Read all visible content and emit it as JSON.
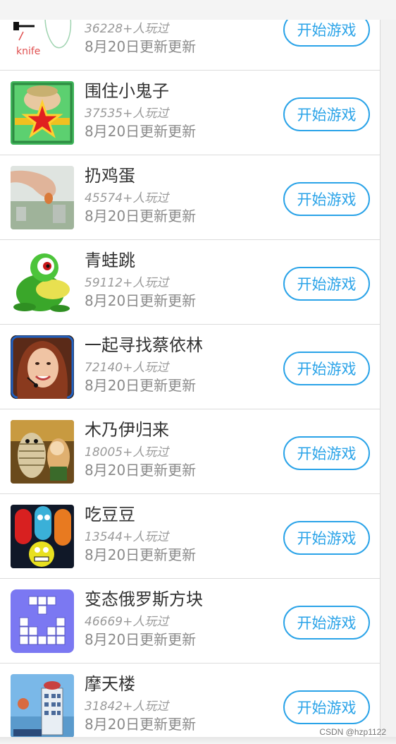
{
  "games": [
    {
      "name": "",
      "plays": "36228+人玩过",
      "updated": "8月20日更新更新",
      "button": "开始游戏",
      "icon": "knife-sketch-icon"
    },
    {
      "name": "围住小鬼子",
      "plays": "37535+人玩过",
      "updated": "8月20日更新更新",
      "button": "开始游戏",
      "icon": "red-star-soldier-icon"
    },
    {
      "name": "扔鸡蛋",
      "plays": "45574+人玩过",
      "updated": "8月20日更新更新",
      "button": "开始游戏",
      "icon": "hand-egg-icon"
    },
    {
      "name": "青蛙跳",
      "plays": "59112+人玩过",
      "updated": "8月20日更新更新",
      "button": "开始游戏",
      "icon": "green-frog-icon"
    },
    {
      "name": "一起寻找蔡依林",
      "plays": "72140+人玩过",
      "updated": "8月20日更新更新",
      "button": "开始游戏",
      "icon": "singer-portrait-icon"
    },
    {
      "name": "木乃伊归来",
      "plays": "18005+人玩过",
      "updated": "8月20日更新更新",
      "button": "开始游戏",
      "icon": "mummy-cartoon-icon"
    },
    {
      "name": "吃豆豆",
      "plays": "13544+人玩过",
      "updated": "8月20日更新更新",
      "button": "开始游戏",
      "icon": "pacman-ghosts-icon"
    },
    {
      "name": "变态俄罗斯方块",
      "plays": "46669+人玩过",
      "updated": "8月20日更新更新",
      "button": "开始游戏",
      "icon": "tetris-blocks-icon"
    },
    {
      "name": "摩天楼",
      "plays": "31842+人玩过",
      "updated": "8月20日更新更新",
      "button": "开始游戏",
      "icon": "skyscraper-icon"
    }
  ],
  "watermark": "CSDN @hzp1122"
}
